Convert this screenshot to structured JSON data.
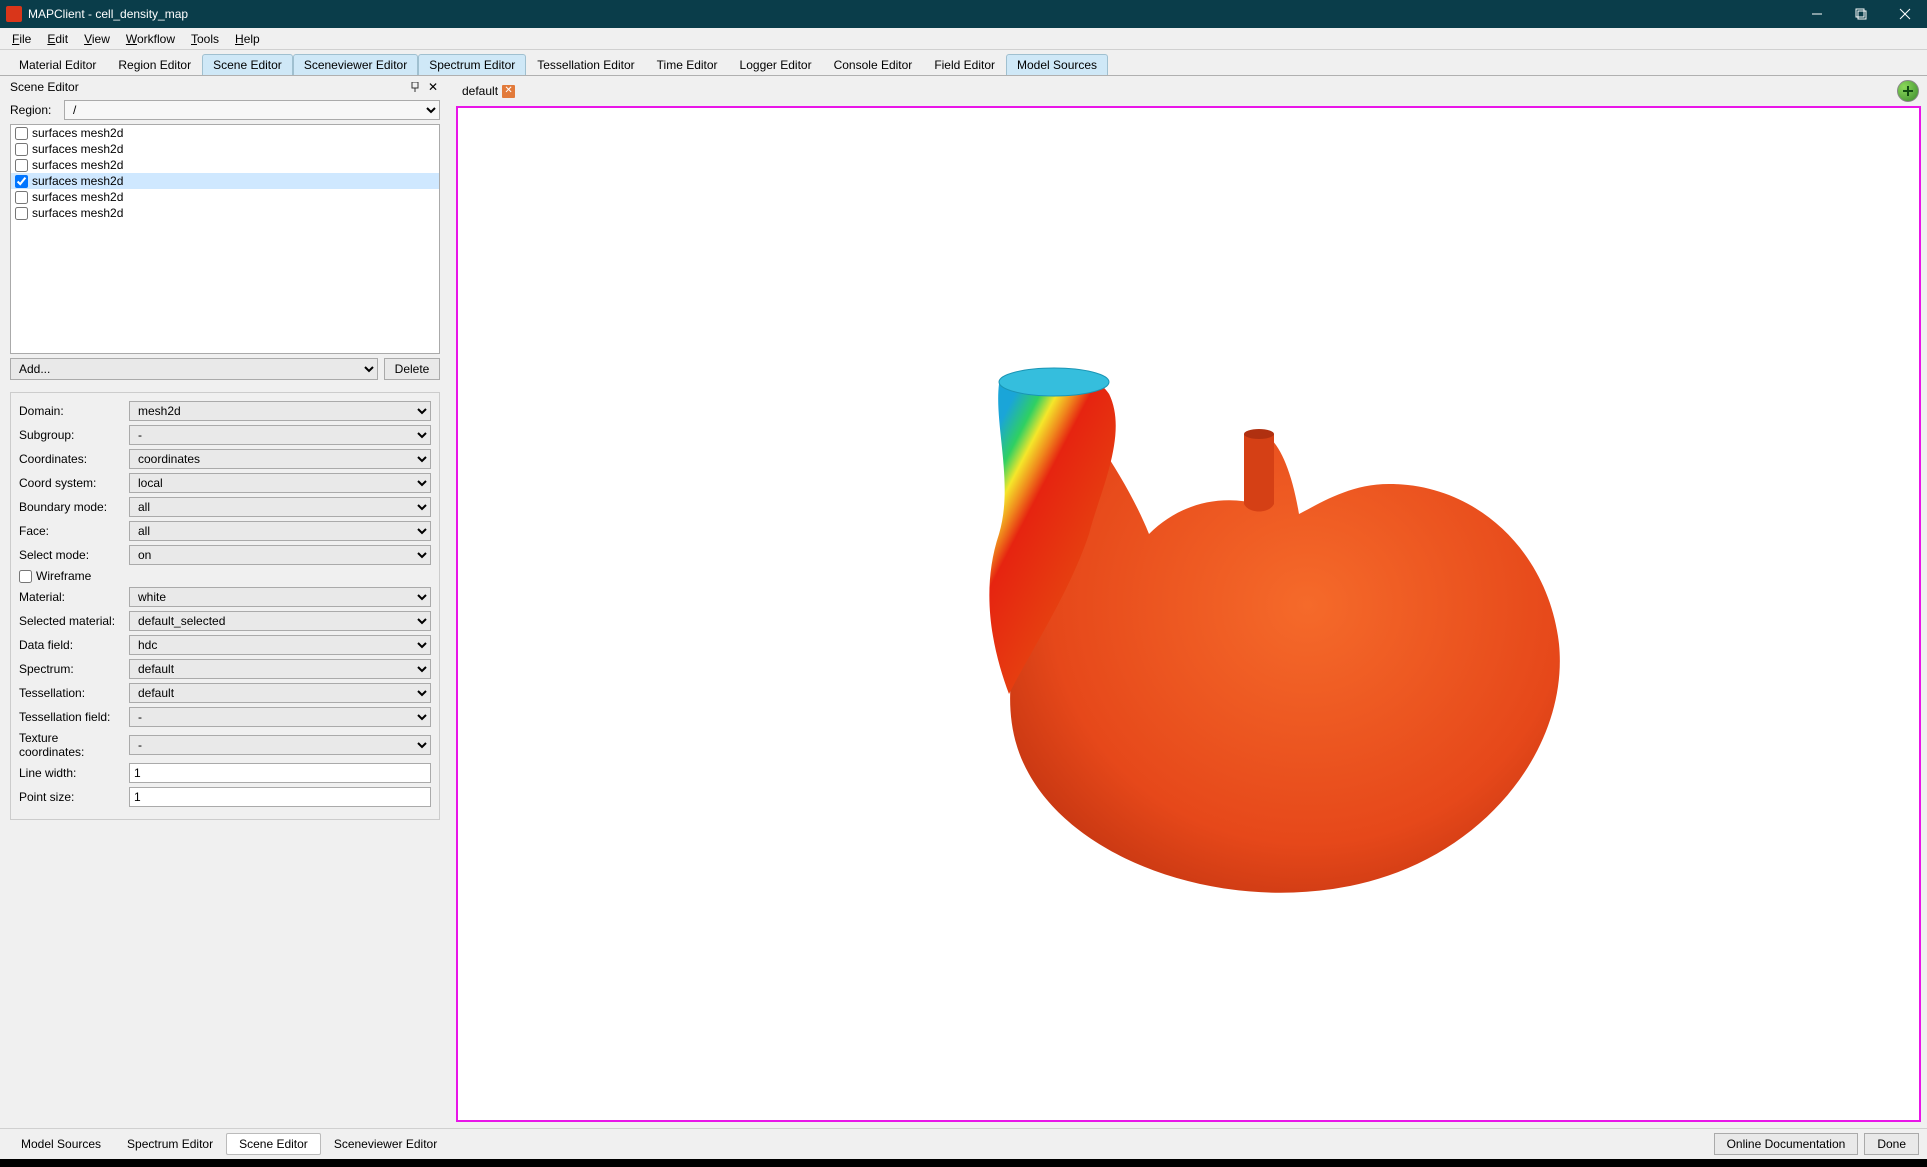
{
  "window": {
    "title": "MAPClient - cell_density_map"
  },
  "menu": {
    "file": "File",
    "edit": "Edit",
    "view": "View",
    "workflow": "Workflow",
    "tools": "Tools",
    "help": "Help"
  },
  "top_tabs": [
    {
      "label": "Material Editor",
      "active": false
    },
    {
      "label": "Region Editor",
      "active": false
    },
    {
      "label": "Scene Editor",
      "active": true
    },
    {
      "label": "Sceneviewer Editor",
      "active": true
    },
    {
      "label": "Spectrum Editor",
      "active": true
    },
    {
      "label": "Tessellation Editor",
      "active": false
    },
    {
      "label": "Time Editor",
      "active": false
    },
    {
      "label": "Logger Editor",
      "active": false
    },
    {
      "label": "Console Editor",
      "active": false
    },
    {
      "label": "Field Editor",
      "active": false
    },
    {
      "label": "Model Sources",
      "active": true
    }
  ],
  "scene_editor": {
    "title": "Scene Editor",
    "region_label": "Region:",
    "region_value": "/",
    "items": [
      {
        "label": "surfaces mesh2d",
        "checked": false,
        "selected": false
      },
      {
        "label": "surfaces mesh2d",
        "checked": false,
        "selected": false
      },
      {
        "label": "surfaces mesh2d",
        "checked": false,
        "selected": false
      },
      {
        "label": "surfaces mesh2d",
        "checked": true,
        "selected": true
      },
      {
        "label": "surfaces mesh2d",
        "checked": false,
        "selected": false
      },
      {
        "label": "surfaces mesh2d",
        "checked": false,
        "selected": false
      }
    ],
    "add_placeholder": "Add...",
    "delete_label": "Delete",
    "props": {
      "domain_label": "Domain:",
      "domain_value": "mesh2d",
      "subgroup_label": "Subgroup:",
      "subgroup_value": "-",
      "coordinates_label": "Coordinates:",
      "coordinates_value": "coordinates",
      "coord_system_label": "Coord system:",
      "coord_system_value": "local",
      "boundary_mode_label": "Boundary mode:",
      "boundary_mode_value": "all",
      "face_label": "Face:",
      "face_value": "all",
      "select_mode_label": "Select mode:",
      "select_mode_value": "on",
      "wireframe_label": "Wireframe",
      "material_label": "Material:",
      "material_value": "white",
      "selected_material_label": "Selected material:",
      "selected_material_value": "default_selected",
      "data_field_label": "Data field:",
      "data_field_value": "hdc",
      "spectrum_label": "Spectrum:",
      "spectrum_value": "default",
      "tessellation_label": "Tessellation:",
      "tessellation_value": "default",
      "tessellation_field_label": "Tessellation field:",
      "tessellation_field_value": "-",
      "texture_coords_label": "Texture coordinates:",
      "texture_coords_value": "-",
      "line_width_label": "Line width:",
      "line_width_value": "1",
      "point_size_label": "Point size:",
      "point_size_value": "1"
    }
  },
  "viewport": {
    "tab_label": "default"
  },
  "bottom_tabs": [
    {
      "label": "Model Sources",
      "active": false
    },
    {
      "label": "Spectrum Editor",
      "active": false
    },
    {
      "label": "Scene Editor",
      "active": true
    },
    {
      "label": "Sceneviewer Editor",
      "active": false
    }
  ],
  "footer": {
    "doc_button": "Online Documentation",
    "done_button": "Done"
  }
}
